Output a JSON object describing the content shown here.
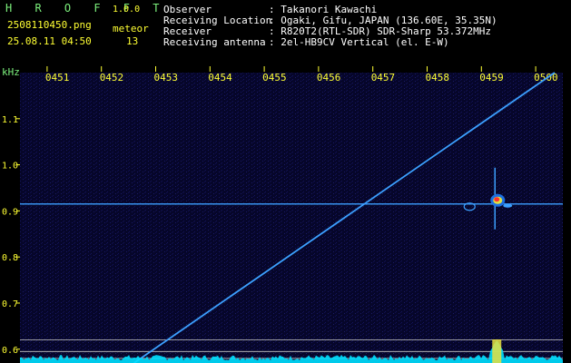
{
  "header": {
    "app_title": "H R O F F T",
    "version": "1.0.0",
    "filename": "2508110450.png",
    "datetime": "25.08.11 04:50",
    "meteor_label": "meteor",
    "meteor_count": "13",
    "info": [
      {
        "label": "Observer",
        "value": ": Takanori Kawachi"
      },
      {
        "label": "Receiving Location",
        "value": ": Ogaki, Gifu, JAPAN (136.60E, 35.35N)"
      },
      {
        "label": "Receiver",
        "value": ": R820T2(RTL-SDR) SDR-Sharp 53.372MHz"
      },
      {
        "label": "Receiving antenna",
        "value": ": 2el-HB9CV Vertical (el. E-W)"
      }
    ]
  },
  "colors": {
    "background": "#000000",
    "spectrum": "#0a0a3a",
    "text_green": "#7cf07c",
    "text_yellow": "#ffff33",
    "signal": "#3ca0ff",
    "intensity": "#00e0ff"
  },
  "chart_data": {
    "type": "heatmap",
    "ylabel": "kHz",
    "x_ticks": [
      "0451",
      "0452",
      "0453",
      "0454",
      "0455",
      "0456",
      "0457",
      "0458",
      "0459",
      "0500"
    ],
    "y_ticks": [
      "1.1",
      "1.0",
      "0.9",
      "0.8",
      "0.7",
      "0.6"
    ],
    "y_range": [
      0.57,
      1.2
    ],
    "x_range_minutes": [
      0,
      10
    ],
    "carrier_khz": 0.915,
    "sweep_line": {
      "start": {
        "minute": 2.1,
        "khz": 0.57
      },
      "end": {
        "minute": 9.85,
        "khz": 1.2
      }
    },
    "meteor_minute": 8.75,
    "guide_lines_khz": [
      0.62,
      0.595,
      0.58
    ]
  }
}
